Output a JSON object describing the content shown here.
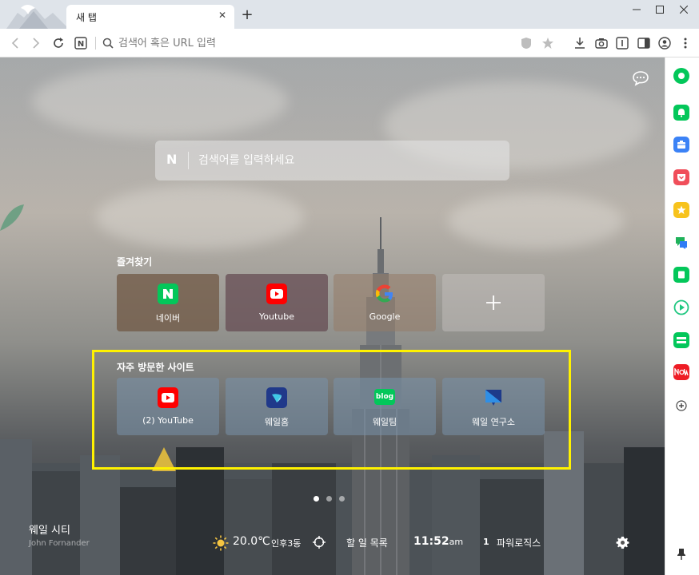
{
  "tab": {
    "title": "새 탭",
    "close": "✕",
    "new_tab": "+"
  },
  "window": {
    "minimize": "—",
    "maximize": "☐",
    "close": "✕"
  },
  "address_bar": {
    "placeholder": "검색어 혹은 URL 입력",
    "naver_btn": "N"
  },
  "search": {
    "logo": "N",
    "placeholder": "검색어를 입력하세요"
  },
  "favorites": {
    "title": "즐겨찾기",
    "items": [
      {
        "label": "네이버",
        "icon": "naver-icon"
      },
      {
        "label": "Youtube",
        "icon": "youtube-icon"
      },
      {
        "label": "Google",
        "icon": "google-icon"
      },
      {
        "label": "",
        "icon": "plus-icon"
      }
    ]
  },
  "frequent": {
    "title": "자주 방문한 사이트",
    "items": [
      {
        "label": "(2) YouTube",
        "icon": "youtube-icon"
      },
      {
        "label": "웨일홈",
        "icon": "whale-icon"
      },
      {
        "label": "웨일팀",
        "icon": "blog-icon",
        "badge": "blog"
      },
      {
        "label": "웨일 연구소",
        "icon": "whale-lab-icon"
      }
    ]
  },
  "footer": {
    "city": "웨일 시티",
    "author": "John Fornander",
    "temperature": "20.0℃",
    "location": "인후3동",
    "todo": "할 일 목록",
    "time": "11:52",
    "ampm": "am",
    "power_count": "1",
    "power_label": "파워로직스"
  },
  "colors": {
    "accent": "#03c75a",
    "highlight": "#fff200",
    "youtube": "#ff0000"
  }
}
